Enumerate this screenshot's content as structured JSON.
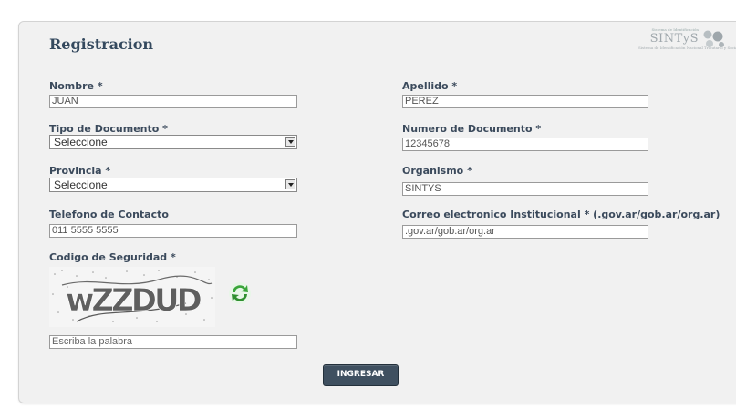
{
  "header": {
    "title": "Registracion",
    "logo_tagline": "Sistema de Identificación",
    "logo_brand": "SINTyS",
    "logo_subtitle": "Sistema de Identificación Nacional Tributario y Social"
  },
  "form": {
    "nombre": {
      "label": "Nombre *",
      "value": "JUAN"
    },
    "apellido": {
      "label": "Apellido *",
      "value": "PEREZ"
    },
    "tipo_documento": {
      "label": "Tipo de Documento *",
      "value": "Seleccione"
    },
    "numero_documento": {
      "label": "Numero de Documento *",
      "value": "12345678"
    },
    "provincia": {
      "label": "Provincia *",
      "value": "Seleccione"
    },
    "organismo": {
      "label": "Organismo *",
      "value": "SINTYS"
    },
    "telefono": {
      "label": "Telefono de Contacto",
      "value": "011 5555 5555"
    },
    "correo": {
      "label": "Correo electronico Institucional * (.gov.ar/gob.ar/org.ar)",
      "value": ".gov.ar/gob.ar/org.ar"
    },
    "codigo": {
      "label": "Codigo de Seguridad *",
      "captcha_text": "wZZDUD",
      "placeholder": "Escriba la palabra"
    },
    "submit_label": "INGRESAR"
  },
  "colors": {
    "title": "#34495e",
    "button_bg": "#3f5060",
    "refresh_green": "#3aa53a"
  }
}
